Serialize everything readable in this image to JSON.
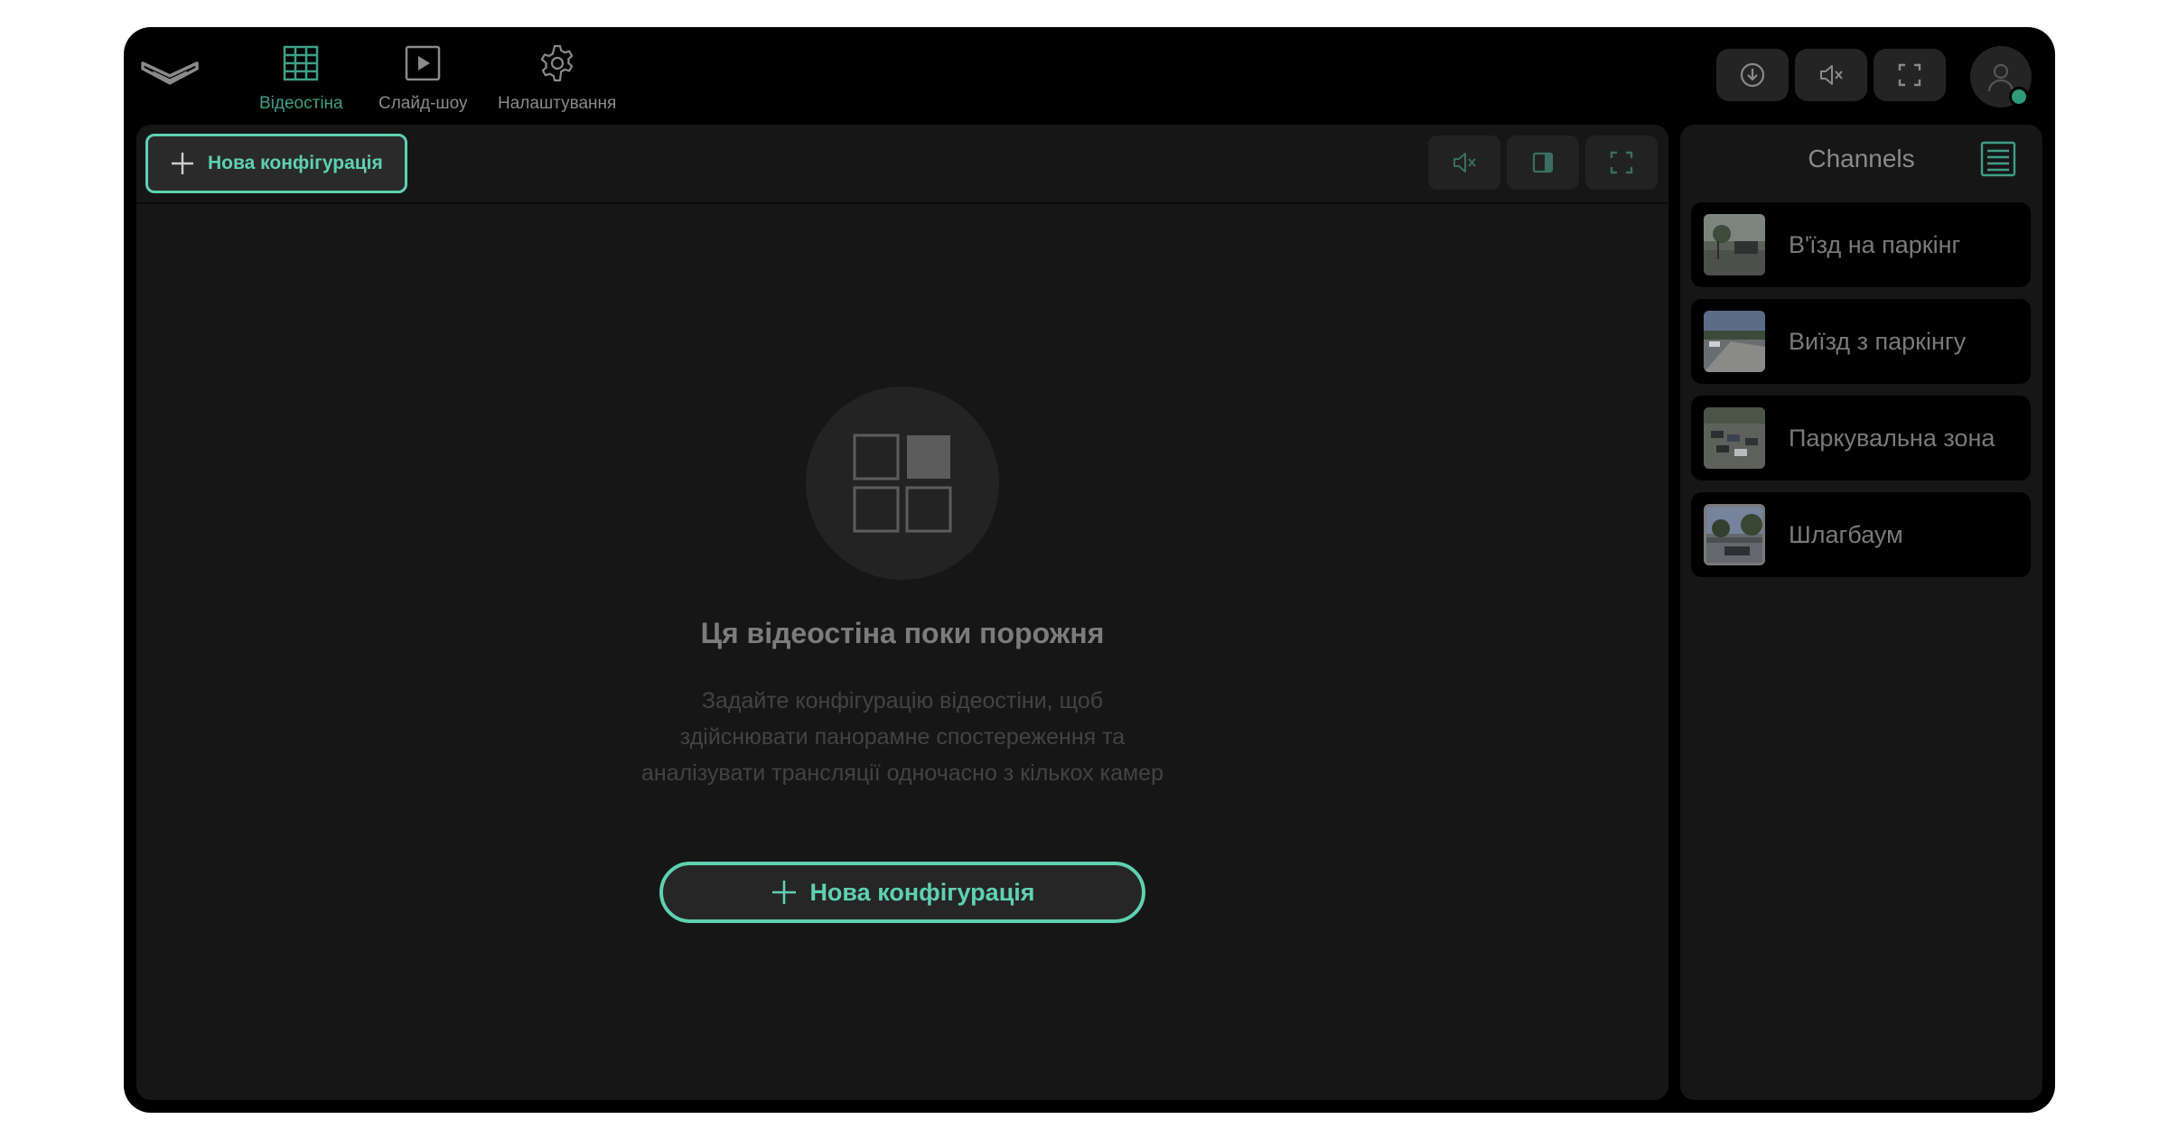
{
  "nav": {
    "items": [
      {
        "label": "Відеостіна",
        "icon": "grid-icon",
        "active": true
      },
      {
        "label": "Слайд-шоу",
        "icon": "play-icon",
        "active": false
      },
      {
        "label": "Налаштування",
        "icon": "gear-icon",
        "active": false
      }
    ]
  },
  "top_actions": [
    "download-icon",
    "mute-icon",
    "fullscreen-icon"
  ],
  "user": {
    "status": "online",
    "status_color": "#2e9a78"
  },
  "main": {
    "new_config_label": "Нова конфігурація",
    "toolbar_icons": [
      "mute-icon",
      "side-panel-icon",
      "fullscreen-icon"
    ],
    "empty_state": {
      "icon": "layout-grid-icon",
      "title": "Ця відеостіна поки порожня",
      "description": "Задайте конфігурацію відеостіни, щоб здійснювати панорамне спостереження та аналізувати трансляції одночасно з кількох камер",
      "button_label": "Нова конфігурація"
    }
  },
  "sidebar": {
    "title": "Channels",
    "channels": [
      {
        "name": "В'їзд на паркінг"
      },
      {
        "name": "Виїзд з паркінгу"
      },
      {
        "name": "Паркувальна зона"
      },
      {
        "name": "Шлагбаум"
      }
    ]
  },
  "colors": {
    "accent": "#5fd1b0",
    "accent_dim": "#3f9f86",
    "background": "#000000",
    "panel": "#161616"
  }
}
